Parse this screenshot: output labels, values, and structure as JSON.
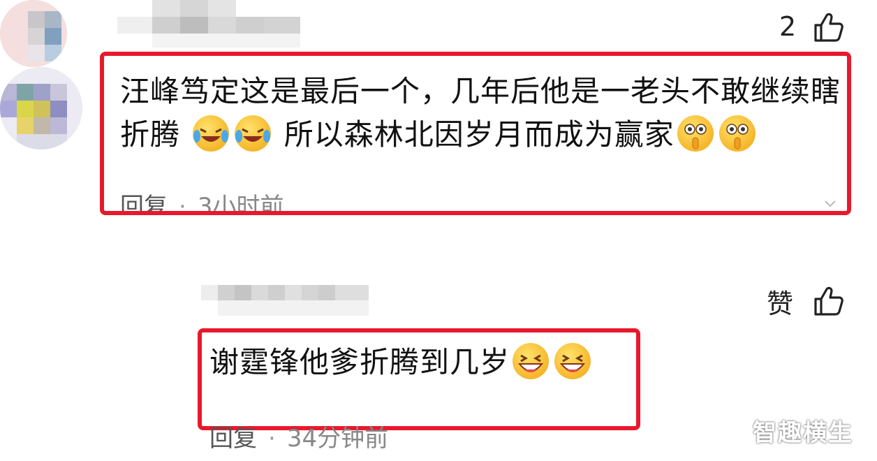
{
  "comments": [
    {
      "like_count": "2",
      "text_part1": "汪峰笃定这是最后一个，几年后他是一老头不敢继续瞎折腾",
      "text_part2": "所以森林北因岁月而成为赢家",
      "reply_label": "回复",
      "separator": "·",
      "time": "3小时前",
      "emojis_mid": [
        "laugh-cry-emoji",
        "laugh-cry-emoji"
      ],
      "emojis_end": [
        "shh-emoji",
        "shh-emoji"
      ]
    },
    {
      "like_label": "赞",
      "text": "谢霆锋他爹折腾到几岁",
      "reply_label": "回复",
      "separator": "·",
      "time": "34分钟前",
      "emojis_end": [
        "grin-emoji",
        "grin-emoji"
      ]
    }
  ],
  "watermark": "智趣横生",
  "colors": {
    "highlight": "#e8192c",
    "emoji": "#f6b62a",
    "meta_text": "#555555"
  }
}
